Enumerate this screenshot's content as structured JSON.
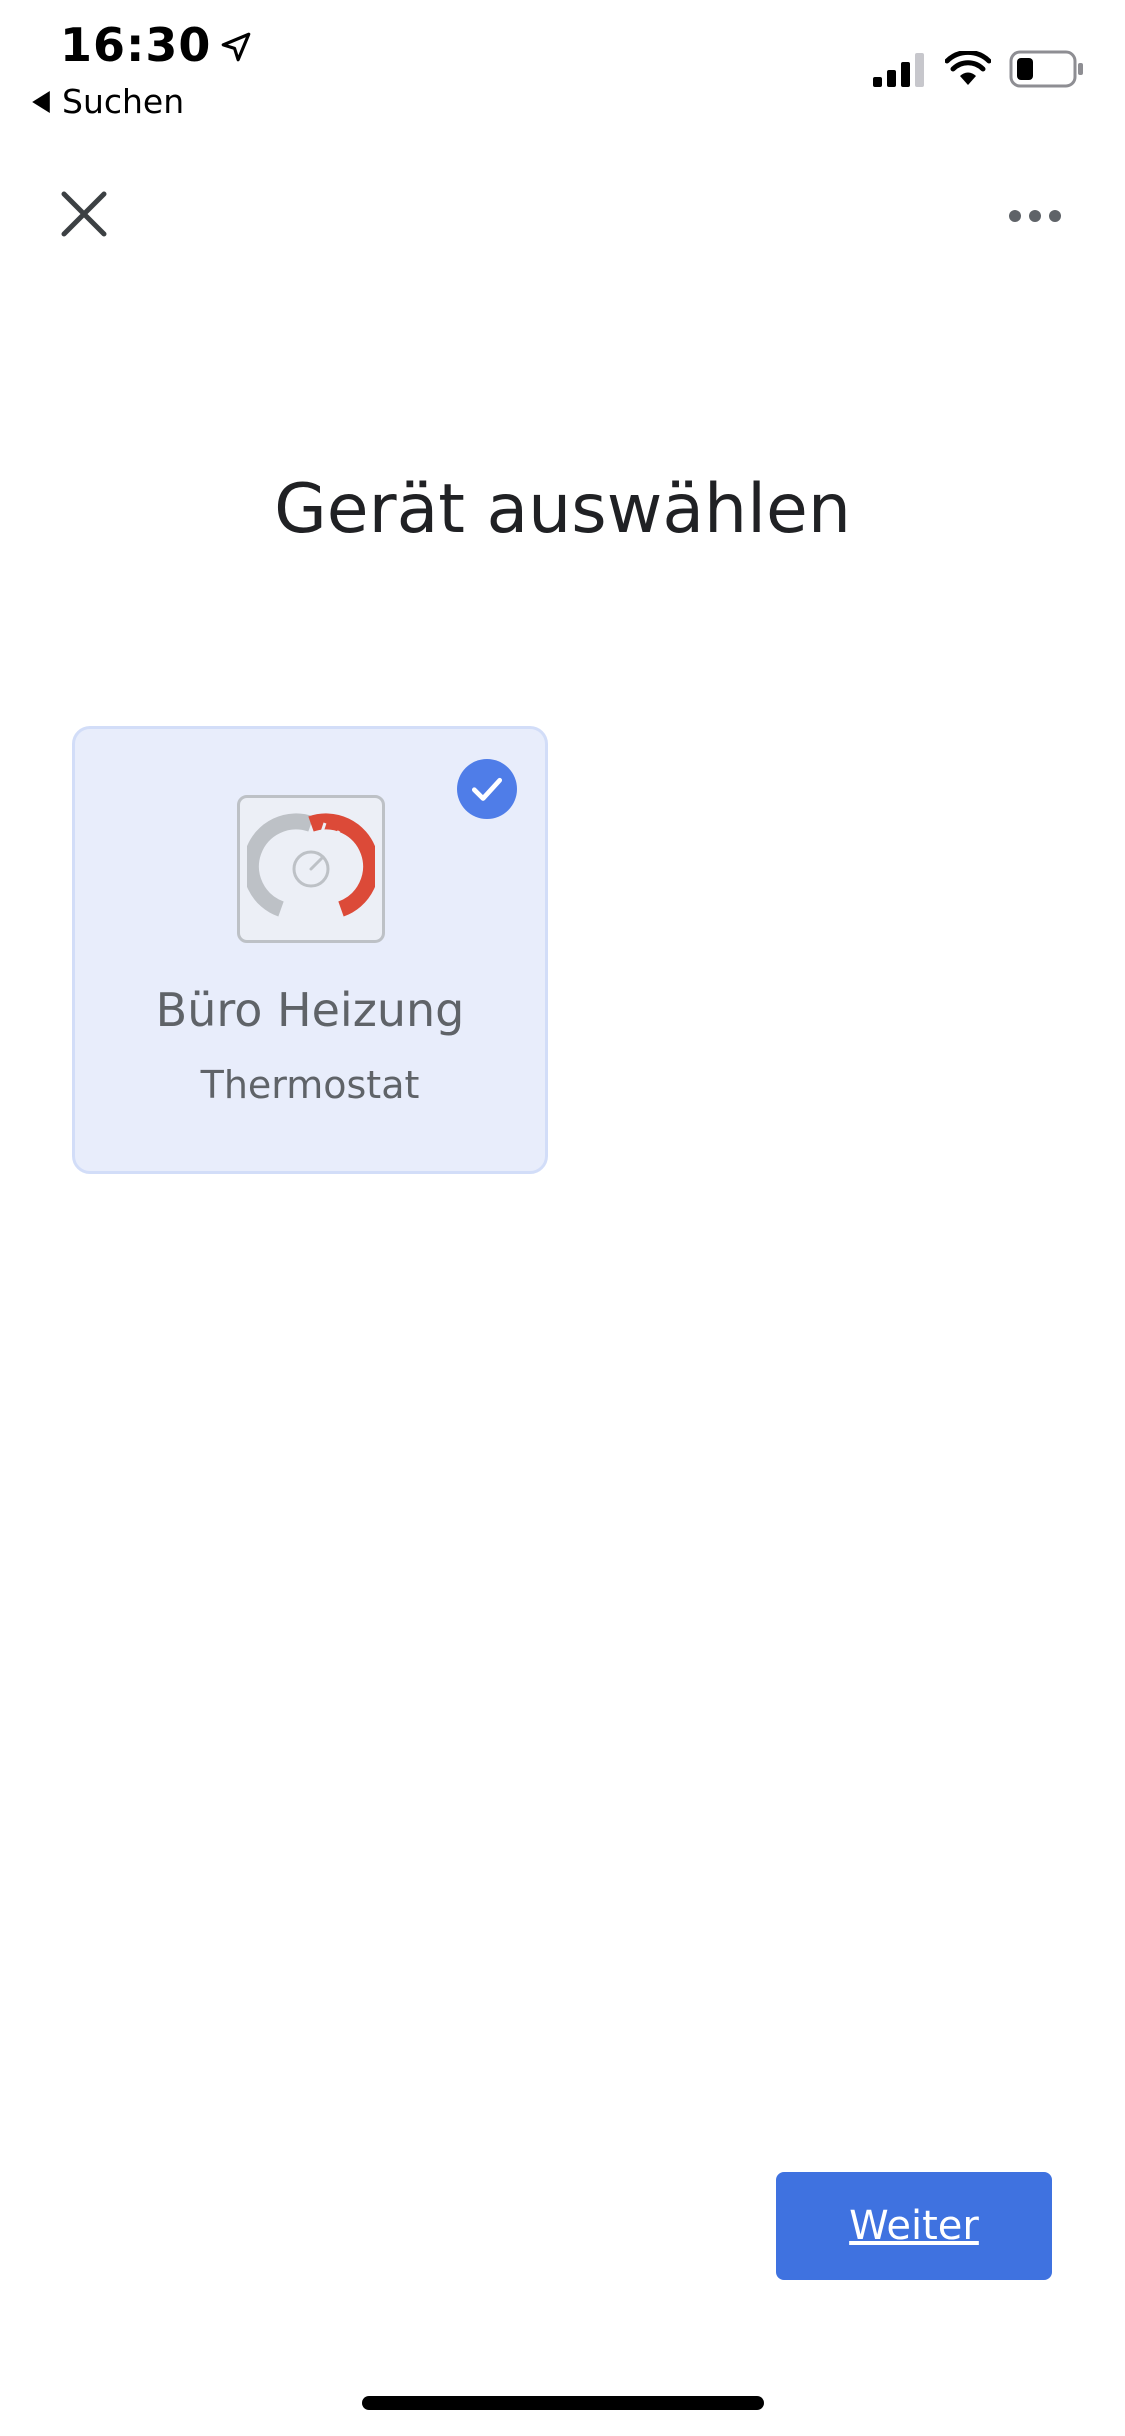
{
  "status_bar": {
    "time": "16:30",
    "back_label": "Suchen",
    "battery_level": 0.3
  },
  "icons": {
    "location": "location-arrow-icon",
    "back": "back-triangle-icon",
    "signal": "cellular-signal-icon",
    "wifi": "wifi-icon",
    "battery": "battery-icon",
    "close": "close-icon",
    "more": "more-horizontal-icon",
    "check": "checkmark-icon",
    "thermostat": "thermostat-icon"
  },
  "colors": {
    "accent": "#3f72e0",
    "card_bg": "#e8edfb",
    "heat_red": "#dc4a38",
    "gauge_gray": "#bdc1c6"
  },
  "page": {
    "title": "Gerät auswählen"
  },
  "devices": [
    {
      "name": "Büro Heizung",
      "type": "Thermostat",
      "selected": true
    }
  ],
  "actions": {
    "next_label": "Weiter"
  }
}
